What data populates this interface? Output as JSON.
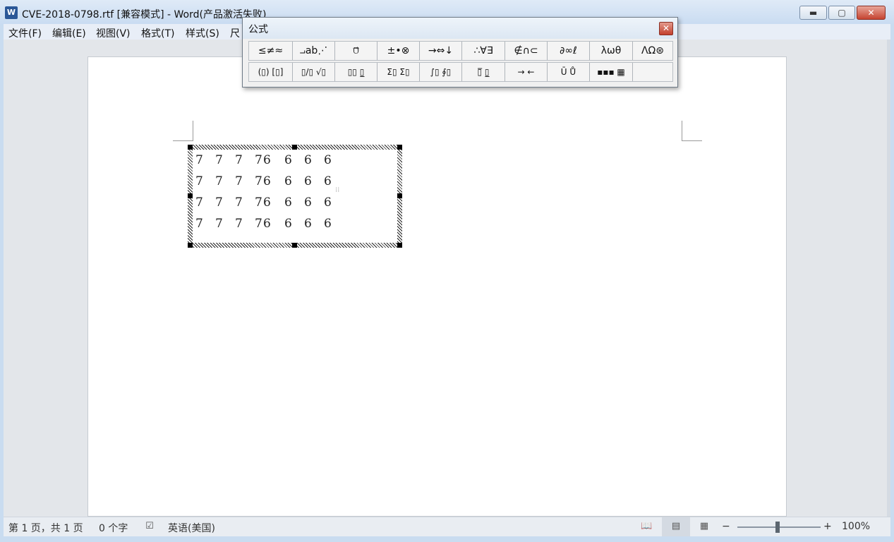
{
  "window": {
    "title": "CVE-2018-0798.rtf [兼容模式] - Word(产品激活失败)",
    "app_icon": "W",
    "minimize_label": "▬",
    "maximize_label": "▢",
    "close_label": "✕"
  },
  "menu": {
    "items": [
      "文件(F)",
      "编辑(E)",
      "视图(V)",
      "格式(T)",
      "样式(S)",
      "尺"
    ]
  },
  "equation": {
    "rows": [
      [
        "7",
        "7",
        "7",
        "7",
        "6",
        "6",
        "6",
        "6"
      ],
      [
        "7",
        "7",
        "7",
        "7",
        "6",
        "6",
        "6",
        "6"
      ],
      [
        "7",
        "7",
        "7",
        "7",
        "6",
        "6",
        "6",
        "6"
      ],
      [
        "7",
        "7",
        "7",
        "7",
        "6",
        "6",
        "6",
        "6"
      ]
    ]
  },
  "equation_toolbar": {
    "title": "公式",
    "close_label": "✕",
    "row1": [
      "≤≠≈",
      "⨼ab⋰",
      "⩌⃗⃛",
      "±•⊗",
      "→⇔↓",
      "∴∀∃",
      "∉∩⊂",
      "∂∞ℓ",
      "λωθ",
      "ΛΩ⊛"
    ],
    "row2": [
      "(▯) [▯]",
      "▯/▯ √▯",
      "▯▯ ▯̲",
      "Σ▯ Σ▯",
      "∫▯ ∮▯",
      "▯̅ ▯̲",
      "→ ←",
      "Ū Ů",
      "▪▪▪ ▦",
      ""
    ]
  },
  "statusbar": {
    "page": "第 1 页，共 1 页",
    "words": "0 个字",
    "language": "英语(美国)",
    "zoom_minus": "−",
    "zoom_plus": "+",
    "zoom": "100%"
  },
  "icons": {
    "proofing": "proofing-icon",
    "read_mode": "read-mode-icon",
    "print_layout": "print-layout-icon",
    "web_layout": "web-layout-icon"
  }
}
